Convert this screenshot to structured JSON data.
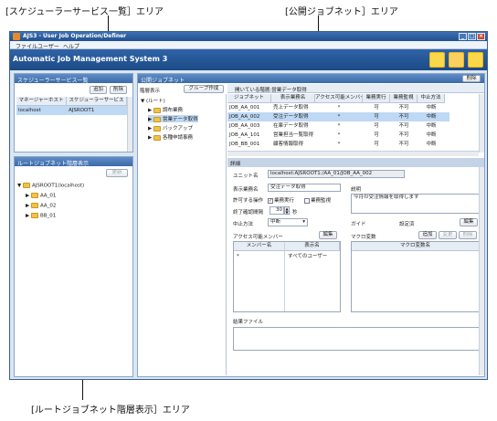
{
  "callouts": {
    "scheduler_area": "[スケジューラーサービス一覧］エリア",
    "public_jobnet_area": "[公開ジョブネット］エリア",
    "root_jobnet_area": "[ルートジョブネット階層表示］エリア"
  },
  "window": {
    "title": "AJS3 - User Job Operation/Definer",
    "menu": [
      "ファイル",
      "ユーザー",
      "ヘルプ"
    ],
    "banner_title": "Automatic Job Management System 3"
  },
  "scheduler_panel": {
    "title": "スケジューラーサービス一覧",
    "add_button": "追加",
    "delete_button": "削除",
    "columns": [
      "マネージャーホスト",
      "スケジューラーサービス"
    ],
    "rows": [
      [
        "localhost",
        "AJSROOT1"
      ]
    ]
  },
  "root_panel": {
    "title": "ルートジョブネット階層表示",
    "update_button": "更新",
    "root_node": "AJSROOT1(localhost)",
    "children": [
      "AA_01",
      "AA_02",
      "BB_01"
    ]
  },
  "public_panel": {
    "title": "公開ジョブネット",
    "delete_button": "削除",
    "hierarchy_label": "階層表示",
    "group_button": "グループ作成",
    "open_path": "開いている階層:営業データ取得",
    "tree_root": "(ルート)",
    "tree_items": [
      "調布業務",
      "営業データ取得",
      "バックアップ",
      "各種申請事務"
    ],
    "columns": [
      "ジョブネット",
      "表示業務名",
      "アクセス可能メンバー",
      "業務実行",
      "業務監視",
      "中止方法"
    ],
    "rows": [
      [
        "JOB_AA_001",
        "売上データ取得",
        "*",
        "可",
        "不可",
        "中断"
      ],
      [
        "JOB_AA_002",
        "受注データ取得",
        "*",
        "可",
        "不可",
        "中断"
      ],
      [
        "JOB_AA_003",
        "在庫データ取得",
        "*",
        "可",
        "不可",
        "中断"
      ],
      [
        "JOB_AA_101",
        "営業担当一覧取得",
        "*",
        "可",
        "不可",
        "中断"
      ],
      [
        "JOB_BB_001",
        "顧客情報取得",
        "*",
        "可",
        "不可",
        "中断"
      ]
    ],
    "selected_row": 1
  },
  "detail_panel": {
    "title": "詳細",
    "unit_label": "ユニット名",
    "unit_value": "localhost:AJSROOT1:/AA_01/JOB_AA_002",
    "display_name_label": "表示業務名",
    "display_name_value": "受注データ取得",
    "description_label": "説明",
    "description_value": "今月の受注情報を取得します",
    "permitted_label": "許可する操作",
    "exec_check": "業務実行",
    "monitor_check": "業務監視",
    "confirm_label": "終了確認間隔",
    "confirm_value": "30",
    "confirm_unit": "秒",
    "abort_label": "中止方法",
    "abort_value": "中断",
    "guide_label": "ガイド",
    "guide_status": "設定済",
    "edit_button": "編集",
    "access_label": "アクセス可能メンバー",
    "access_edit_button": "編集",
    "member_columns": [
      "メンバー名",
      "表示名"
    ],
    "member_rows": [
      [
        "*",
        "すべてのユーザー"
      ]
    ],
    "macro_label": "マクロ変数",
    "macro_add": "追加",
    "macro_change": "変更",
    "macro_delete": "削除",
    "macro_column": "マクロ変数名",
    "result_label": "結果ファイル"
  },
  "colors": {
    "banner": "#2f64a8",
    "panel_header": "#4b7bbc",
    "selection": "#bfd8f3"
  },
  "icons": [
    "user-icon",
    "users-icon",
    "settings-icon"
  ]
}
